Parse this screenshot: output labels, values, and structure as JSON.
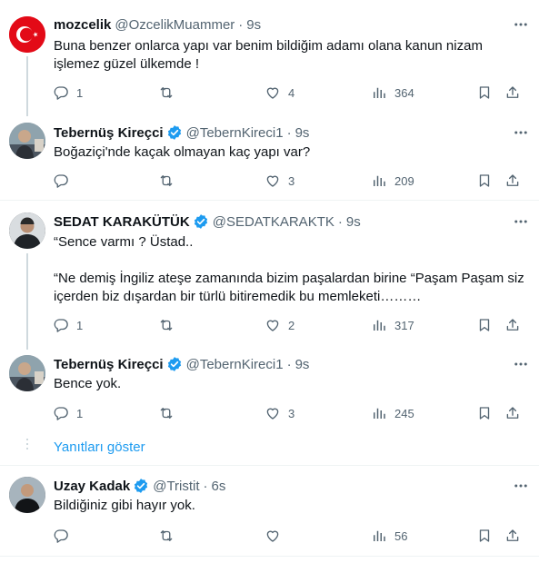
{
  "colors": {
    "accent": "#1d9bf0",
    "muted": "#536471",
    "text": "#0f1419",
    "line": "#cfd9de"
  },
  "tweets": [
    {
      "name": "mozcelik",
      "handle": "@OzcelikMuammer",
      "time": "9s",
      "verified": false,
      "avatar": "turkish-flag-avatar",
      "text": "Buna benzer onlarca yapı var benim bildiğim adamı olana kanun nizam işlemez güzel ülkemde !",
      "replies": "1",
      "retweets": "",
      "likes": "4",
      "views": "364"
    },
    {
      "name": "Tebernüş Kireçci",
      "handle": "@TebernKireci1",
      "time": "9s",
      "verified": true,
      "avatar": "man-outdoor-avatar",
      "text": "Boğaziçi'nde kaçak olmayan kaç yapı var?",
      "replies": "",
      "retweets": "",
      "likes": "3",
      "views": "209"
    },
    {
      "name": "SEDAT KARAKÜTÜK",
      "handle": "@SEDATKARAKTK",
      "time": "9s",
      "verified": true,
      "avatar": "man-dark-avatar",
      "text": "“Sence varmı ? Üstad..\n\n“Ne demiş İngiliz ateşe zamanında bizim paşalardan birine “Paşam Paşam siz içerden biz dışardan bir türlü bitiremedik bu memleketi………",
      "replies": "1",
      "retweets": "",
      "likes": "2",
      "views": "317"
    },
    {
      "name": "Tebernüş Kireçci",
      "handle": "@TebernKireci1",
      "time": "9s",
      "verified": true,
      "avatar": "man-outdoor-avatar",
      "text": "Bence yok.",
      "replies": "1",
      "retweets": "",
      "likes": "3",
      "views": "245"
    },
    {
      "name": "Uzay Kadak",
      "handle": "@Tristit",
      "time": "6s",
      "verified": true,
      "avatar": "man-black-shirt-avatar",
      "text": "Bildiğiniz gibi hayır yok.",
      "replies": "",
      "retweets": "",
      "likes": "",
      "views": "56"
    }
  ],
  "show_replies_label": "Yanıtları göster",
  "separator": "·"
}
